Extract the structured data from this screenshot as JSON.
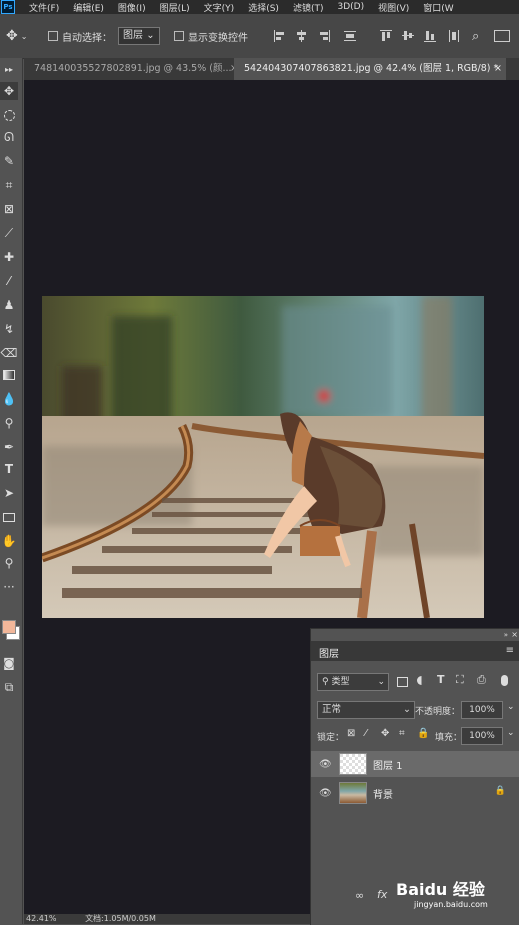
{
  "menubar": {
    "logo": "Ps",
    "items": [
      "文件(F)",
      "编辑(E)",
      "图像(I)",
      "图层(L)",
      "文字(Y)",
      "选择(S)",
      "滤镜(T)",
      "3D(D)",
      "视图(V)",
      "窗口(W"
    ]
  },
  "options_bar": {
    "auto_select_label": "自动选择：",
    "auto_select_value": "图层",
    "show_transform_label": "显示变换控件"
  },
  "tabs": [
    {
      "label": "748140035527802891.jpg @ 43.5% (颜..."
    },
    {
      "label": "542404307407863821.jpg @ 42.4% (图层 1, RGB/8) *"
    }
  ],
  "layers_panel": {
    "title": "图层",
    "filter_value": "类型",
    "blend_mode": "正常",
    "opacity_label": "不透明度：",
    "opacity_value": "100%",
    "lock_label": "锁定：",
    "fill_label": "填充：",
    "fill_value": "100%",
    "layers": [
      {
        "name": "图层 1",
        "selected": true
      },
      {
        "name": "背景",
        "locked": true
      }
    ]
  },
  "status": {
    "zoom": "42.41%",
    "doc": "文档:1.05M/0.05M"
  },
  "watermark": {
    "brand": "Baidu 经验",
    "url": "jingyan.baidu.com"
  },
  "colors": {
    "foreground": "#f2b79a",
    "background": "#ffffff",
    "selection": "#6a6a6a"
  }
}
